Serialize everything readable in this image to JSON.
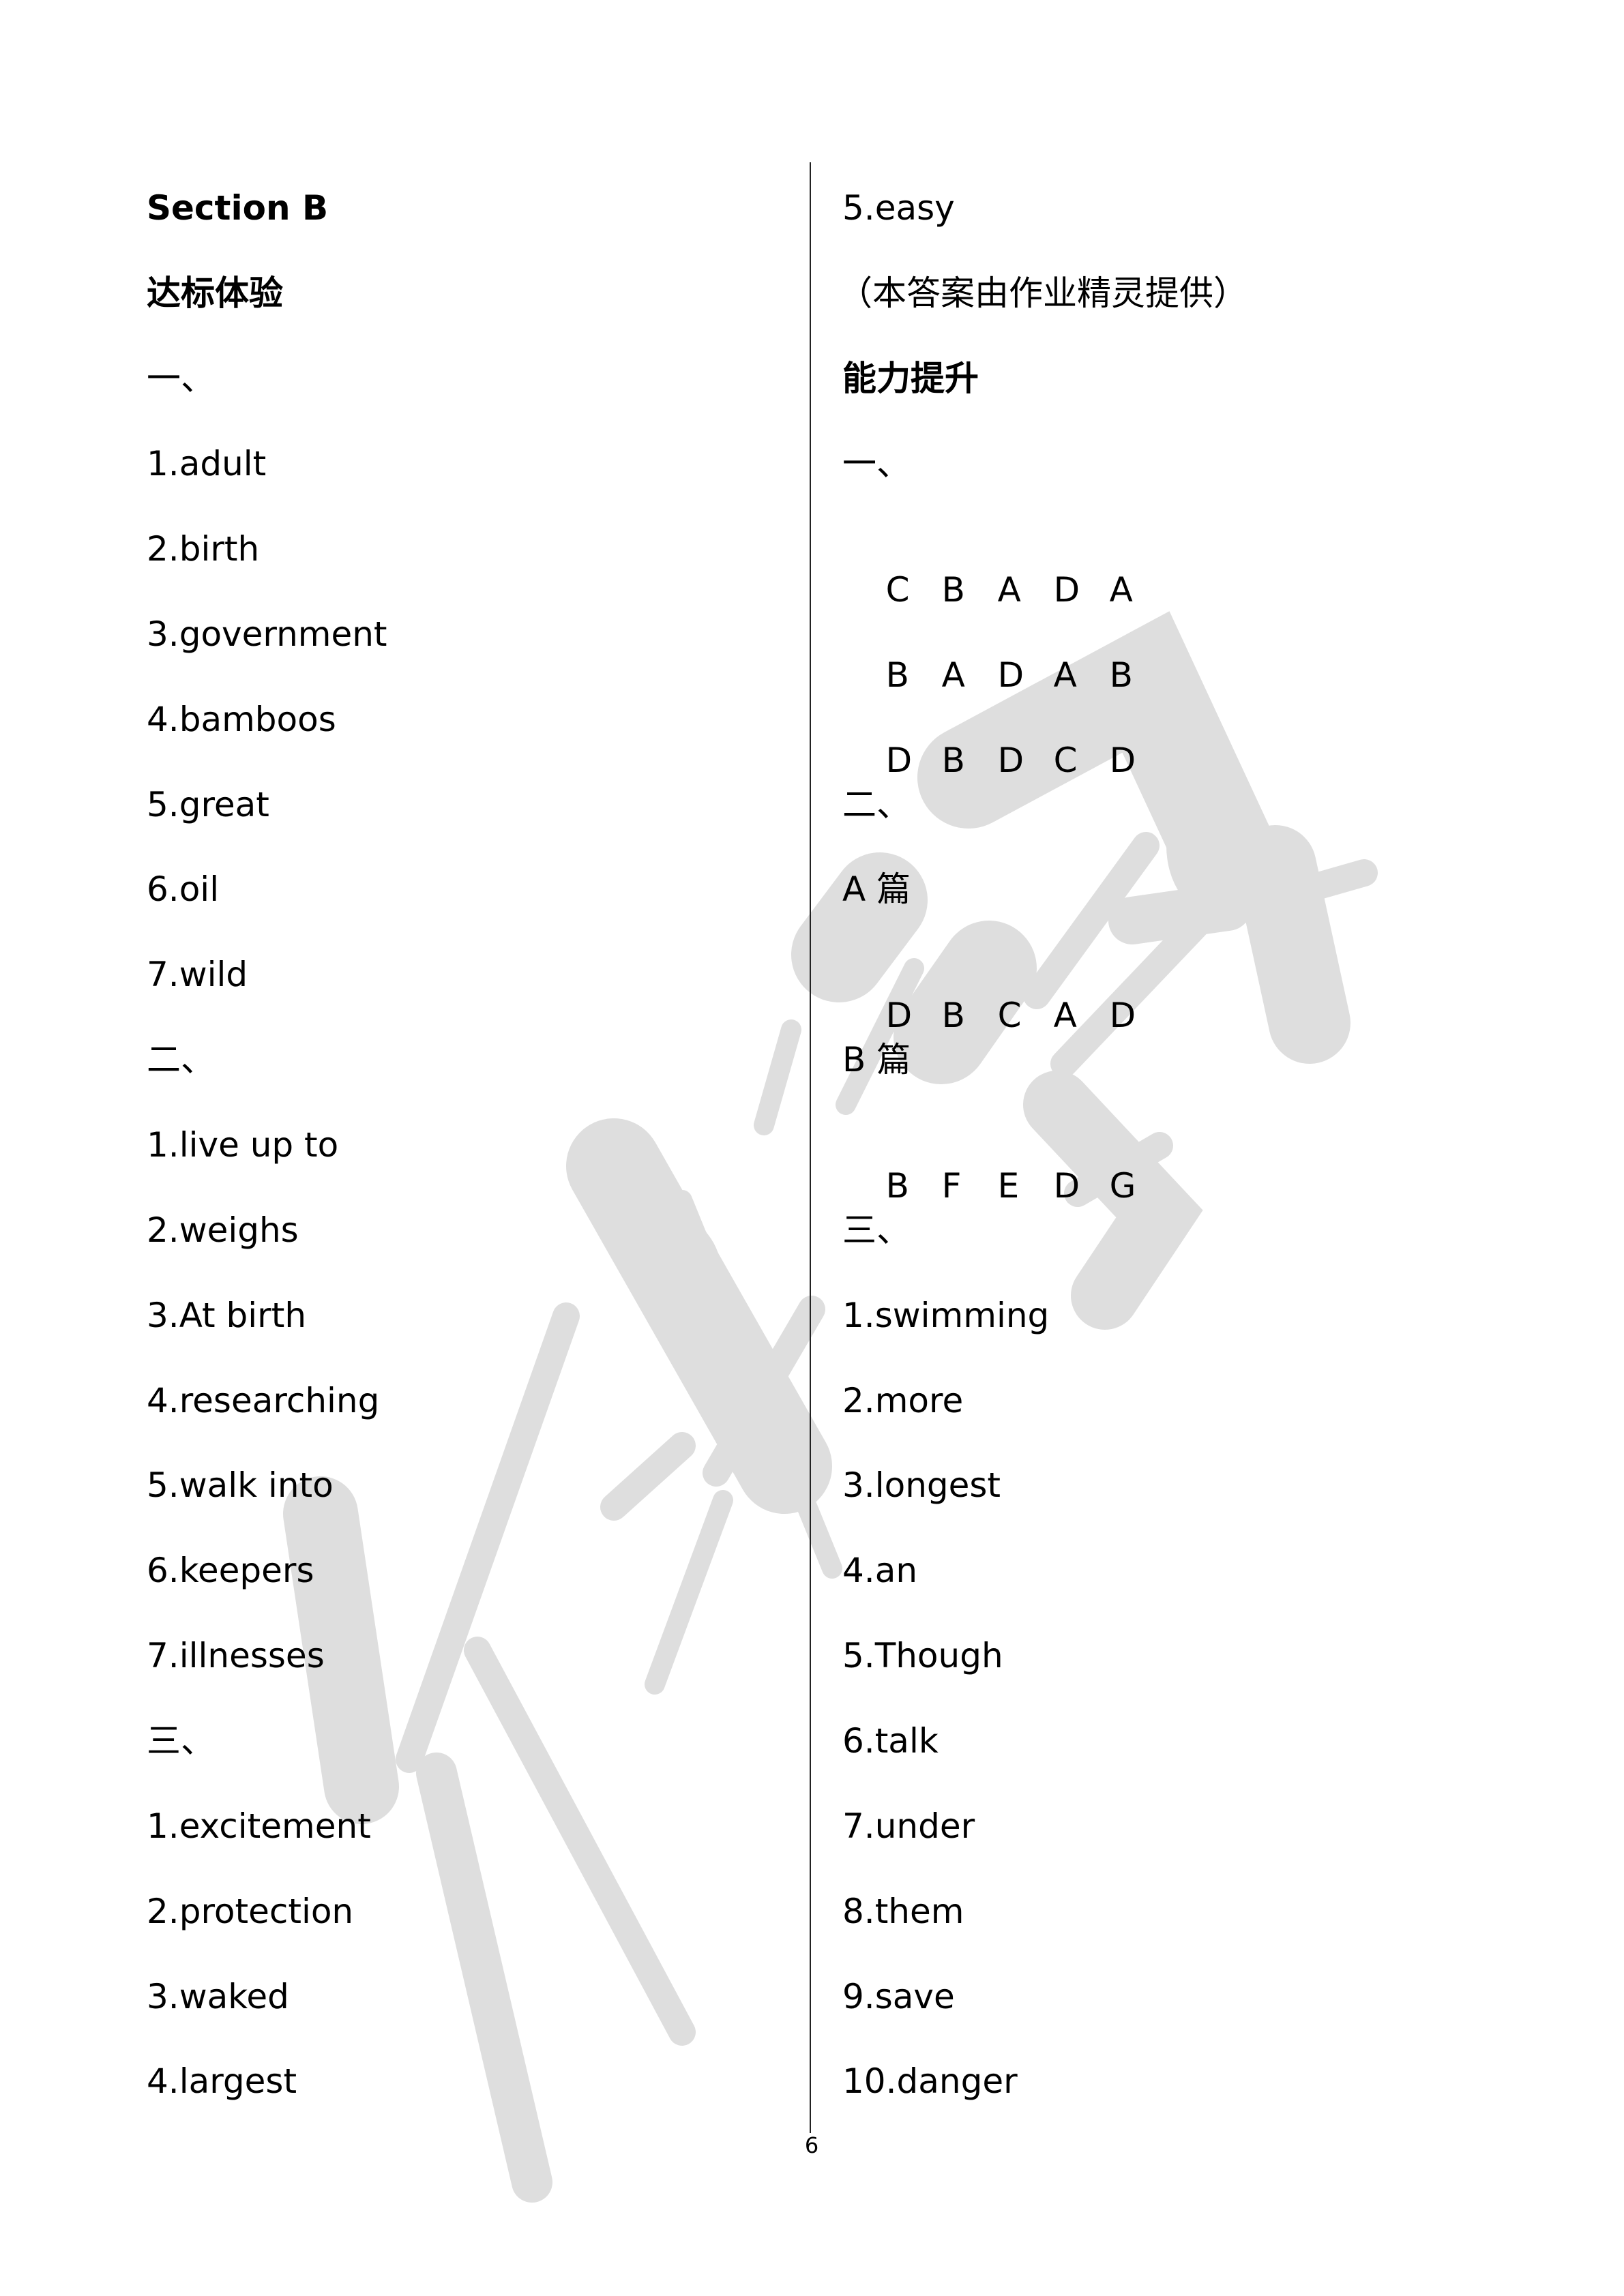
{
  "page": {
    "page_number": "6",
    "watermark_color": "#dedede",
    "text_color": "#000000"
  },
  "left_column": {
    "section_title": "Section B",
    "subsection_title": "达标体验",
    "parts": [
      {
        "heading": "一、",
        "answers": [
          "1.adult",
          "2.birth",
          "3.government",
          "4.bamboos",
          "5.great",
          "6.oil",
          "7.wild"
        ]
      },
      {
        "heading": "二、",
        "answers": [
          "1.live up to",
          "2.weighs",
          "3.At birth",
          "4.researching",
          "5.walk into",
          "6.keepers",
          "7.illnesses"
        ]
      },
      {
        "heading": "三、",
        "answers": [
          "1.excitement",
          "2.protection",
          "3.waked",
          "4.largest"
        ]
      }
    ]
  },
  "right_column": {
    "continued_answer": "5.easy",
    "credit_note": "（本答案由作业精灵提供）",
    "subsection_title": "能力提升",
    "part_one": {
      "heading": "一、",
      "rows": [
        [
          "C",
          "B",
          "A",
          "D",
          "A"
        ],
        [
          "B",
          "A",
          "D",
          "A",
          "B"
        ],
        [
          "D",
          "B",
          "D",
          "C",
          "D"
        ]
      ]
    },
    "part_two": {
      "heading": "二、",
      "passages": [
        {
          "label": "A 篇",
          "answers": [
            "D",
            "B",
            "C",
            "A",
            "D"
          ]
        },
        {
          "label": "B 篇",
          "answers": [
            "B",
            "F",
            "E",
            "D",
            "G"
          ]
        }
      ]
    },
    "part_three": {
      "heading": "三、",
      "answers": [
        "1.swimming",
        "2.more",
        "3.longest",
        "4.an",
        "5.Though",
        "6.talk",
        "7.under",
        "8.them",
        "9.save",
        "10.danger"
      ]
    }
  }
}
